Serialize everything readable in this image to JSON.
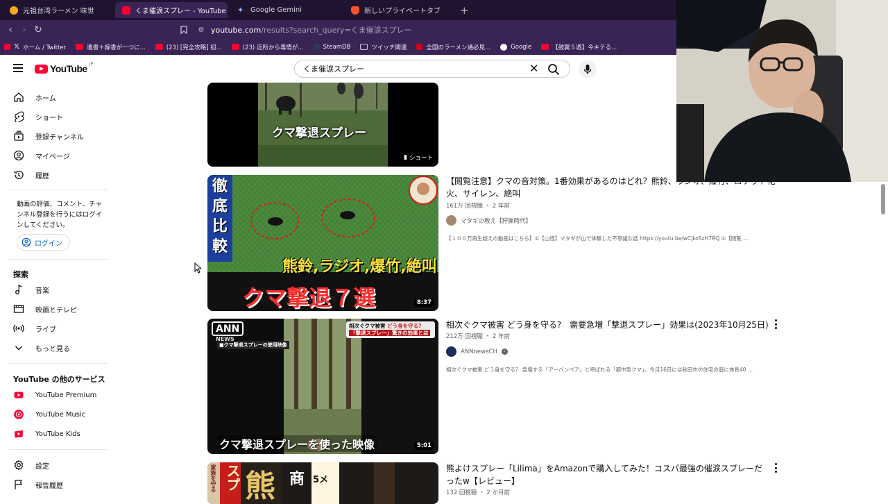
{
  "browser": {
    "tabs": [
      {
        "title": "元祖台湾ラーメン 味世",
        "active": false,
        "favicon_color": "#f5a623"
      },
      {
        "title": "くま催涙スプレー - YouTube",
        "active": true,
        "favicon_color": "#ff0033"
      },
      {
        "title": "Google Gemini",
        "active": false,
        "favicon_color": "#7c9cf5"
      },
      {
        "title": "新しいプライベートタブ",
        "active": false,
        "favicon_color": "#fb542b"
      }
    ],
    "url_host": "youtube.com",
    "url_path": "/results?search_query=くま催涙スプレー",
    "bookmarks": [
      {
        "label": "ホーム / Twitter",
        "color": "#ffffff"
      },
      {
        "label": "遺書＋嫁書が一つに...",
        "color": "#ff0033"
      },
      {
        "label": "(23) [完全攻略] 初...",
        "color": "#ff0033"
      },
      {
        "label": "(23) 近所から毒情が...",
        "color": "#ff0033"
      },
      {
        "label": "SteamDB",
        "color": "#2b3a55"
      },
      {
        "label": "ツイッチ関連",
        "color": "#cfc8dc"
      },
      {
        "label": "全国のラーメン通必見...",
        "color": "#d0021b"
      },
      {
        "label": "Google",
        "color": "#ffffff"
      },
      {
        "label": "【鼓翼５週】今キテる...",
        "color": "#ff0033"
      }
    ]
  },
  "masthead": {
    "logo_text": "YouTube",
    "region": "JP",
    "search_value": "くま催涙スプレー"
  },
  "sidebar": {
    "main": [
      {
        "label": "ホーム",
        "icon": "home-icon"
      },
      {
        "label": "ショート",
        "icon": "shorts-icon"
      },
      {
        "label": "登録チャンネル",
        "icon": "subscriptions-icon"
      },
      {
        "label": "マイページ",
        "icon": "you-icon"
      },
      {
        "label": "履歴",
        "icon": "history-icon"
      }
    ],
    "signin_text": "動画の評価、コメント、チャンネル登録を行うにはログインしてください。",
    "signin_button": "ログイン",
    "explore_heading": "探索",
    "explore": [
      {
        "label": "音楽",
        "icon": "music-icon"
      },
      {
        "label": "映画とテレビ",
        "icon": "movies-icon"
      },
      {
        "label": "ライブ",
        "icon": "live-icon"
      },
      {
        "label": "もっと見る",
        "icon": "chevron-down-icon"
      }
    ],
    "services_heading": "YouTube の他のサービス",
    "services": [
      {
        "label": "YouTube Premium",
        "icon": "youtube-premium-icon"
      },
      {
        "label": "YouTube Music",
        "icon": "youtube-music-icon"
      },
      {
        "label": "YouTube Kids",
        "icon": "youtube-kids-icon"
      }
    ],
    "bottom": [
      {
        "label": "設定",
        "icon": "settings-icon"
      },
      {
        "label": "報告履歴",
        "icon": "flag-icon"
      }
    ]
  },
  "results": {
    "short": {
      "overlay_text": "クマ撃退スプレー",
      "badge": "ショート"
    },
    "videos": [
      {
        "title": "【閲覧注意】クマの音対策。1番効果があるのはどれ？熊鈴、ラジオ、爆竹、ロケット花火、サイレン、絶叫",
        "views": "161万 回視聴",
        "age": "2 年前",
        "channel": "マタギの教え【狩猟時代】",
        "verified": false,
        "description": "【１００万再生超えの動画はこちら】①【山怪】マタギが山で体験した不思議な話 https://youtu.be/wCjkoSzH7RQ ②【閲覧 ...",
        "duration": "8:37",
        "thumb_text": {
          "vertical": "徹底比較",
          "items": "熊鈴,ラジオ,爆竹,絶叫",
          "main": "クマ撃退７選"
        }
      },
      {
        "title": "相次ぐクマ被害 どう身を守る?　需要急増「撃退スプレー」効果は(2023年10月25日)",
        "views": "212万 回視聴",
        "age": "2 年前",
        "channel": "ANNnewsCH",
        "verified": true,
        "description": "相次ぐクマ被害 どう身を守る？ 急増する「アーバンベア」と呼ばれる「都市型クマ」。今月16日には秋田市の住宅の庭に体長40 ...",
        "duration": "5:01",
        "thumb_text": {
          "logo": "ANN",
          "logo_sub": "NEWS",
          "caption_top": "■クマ撃退スプレーの使用映像",
          "side1": "相次ぐクマ被害",
          "side2": "どう身を守る?",
          "side3": "「撃退スプレー」驚きの効果とは",
          "bottom": "クマ撃退スプレーを使った映像"
        }
      },
      {
        "title": "熊よけスプレー「Lilima」をAmazonで購入してみた！コスパ最強の催涙スプレーだったw【レビュー】",
        "views": "132 回視聴",
        "age": "2 か月前",
        "thumb_text": {
          "a": "家族を守る",
          "b": "スプ",
          "c": "熊",
          "d": "商",
          "e": "5メ"
        }
      }
    ]
  },
  "colors": {
    "youtube_red": "#ff0033",
    "link_blue": "#065fd4",
    "browser_bg": "#3a2456"
  }
}
